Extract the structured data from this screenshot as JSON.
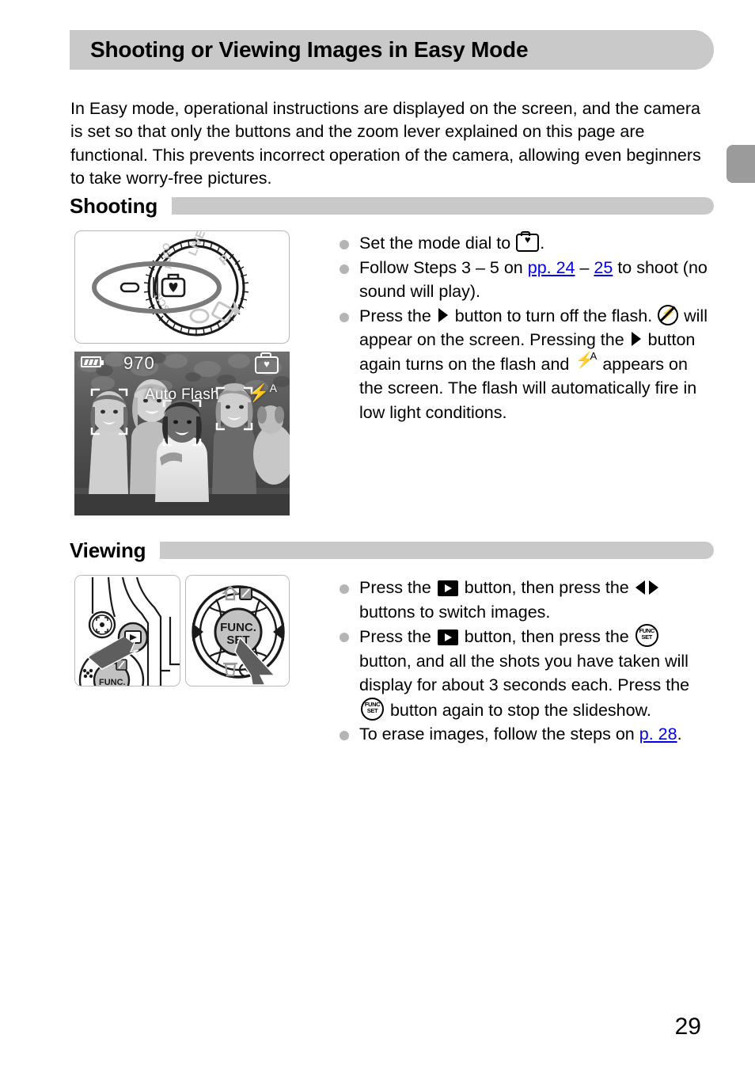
{
  "page": {
    "title": "Shooting or Viewing Images in Easy Mode",
    "number": "29",
    "intro": "In Easy mode, operational instructions are displayed on the screen, and the camera is set so that only the buttons and the zoom lever explained on this page are functional. This prevents incorrect operation of the camera, allowing even beginners to take worry-free pictures."
  },
  "sections": {
    "shooting": {
      "heading": "Shooting",
      "bullets": [
        {
          "id": "set-mode-dial",
          "parts": [
            {
              "type": "text",
              "value": "Set the mode dial to "
            },
            {
              "type": "icon",
              "value": "easy-mode-icon"
            },
            {
              "type": "text",
              "value": "."
            }
          ]
        },
        {
          "id": "follow-steps",
          "parts": [
            {
              "type": "text",
              "value": "Follow Steps 3 – 5 on "
            },
            {
              "type": "link",
              "value": "pp. 24"
            },
            {
              "type": "text",
              "value": " – "
            },
            {
              "type": "link",
              "value": "25"
            },
            {
              "type": "text",
              "value": " to shoot (no sound will play)."
            }
          ]
        },
        {
          "id": "flash-toggle",
          "parts": [
            {
              "type": "text",
              "value": "Press the "
            },
            {
              "type": "icon",
              "value": "right-arrow-icon"
            },
            {
              "type": "text",
              "value": " button to turn off the flash. "
            },
            {
              "type": "icon",
              "value": "flash-off-icon"
            },
            {
              "type": "text",
              "value": " will appear on the screen. Pressing the "
            },
            {
              "type": "icon",
              "value": "right-arrow-icon"
            },
            {
              "type": "text",
              "value": " button again turns on the flash and "
            },
            {
              "type": "icon",
              "value": "flash-auto-icon"
            },
            {
              "type": "text",
              "value": " appears on the screen. The flash will automatically fire in low light conditions."
            }
          ]
        }
      ],
      "figures": {
        "mode_dial": {
          "name": "mode-dial-illustration",
          "dial_labels": [
            "P",
            "LIVE",
            "AUTO",
            "SCN"
          ],
          "selected_position": "easy-mode"
        },
        "lcd": {
          "name": "camera-lcd-preview",
          "shots_remaining": "970",
          "status_label": "Auto Flash",
          "battery": "full",
          "mode_icon": "easy-mode-icon",
          "flash_icon": "flash-auto-icon",
          "flash_superscript": "A"
        }
      }
    },
    "viewing": {
      "heading": "Viewing",
      "bullets": [
        {
          "id": "switch-images",
          "parts": [
            {
              "type": "text",
              "value": "Press the "
            },
            {
              "type": "icon",
              "value": "playback-icon"
            },
            {
              "type": "text",
              "value": " button, then press the "
            },
            {
              "type": "icon",
              "value": "left-right-arrows-icon"
            },
            {
              "type": "text",
              "value": " buttons to switch images."
            }
          ]
        },
        {
          "id": "slideshow",
          "parts": [
            {
              "type": "text",
              "value": "Press the "
            },
            {
              "type": "icon",
              "value": "playback-icon"
            },
            {
              "type": "text",
              "value": " button, then press the "
            },
            {
              "type": "icon",
              "value": "func-set-icon"
            },
            {
              "type": "text",
              "value": " button, and all the shots you have taken will display for about 3 seconds each. Press the "
            },
            {
              "type": "icon",
              "value": "func-set-icon"
            },
            {
              "type": "text",
              "value": " button again to stop the slideshow."
            }
          ]
        },
        {
          "id": "erase-images",
          "parts": [
            {
              "type": "text",
              "value": "To erase images, follow the steps on "
            },
            {
              "type": "link",
              "value": "p. 28"
            },
            {
              "type": "text",
              "value": "."
            }
          ]
        }
      ],
      "figures": {
        "camera_back": {
          "name": "camera-back-playback-button-illustration",
          "highlight": "playback-button"
        },
        "dpad": {
          "name": "func-set-dial-illustration",
          "center_label_line1": "FUNC.",
          "center_label_line2": "SET",
          "top_icons": [
            "print-share-icon",
            "exposure-comp-icon"
          ],
          "bottom_icons": [
            "trash-icon",
            "self-timer-icon"
          ],
          "left_icon": "macro-icon",
          "right_icon": "flash-icon"
        }
      }
    }
  },
  "colors": {
    "header_gray": "#c9c9c9",
    "tab_gray": "#9b9b9b",
    "bullet_gray": "#b5b5b5",
    "link_blue": "#0000ee"
  }
}
